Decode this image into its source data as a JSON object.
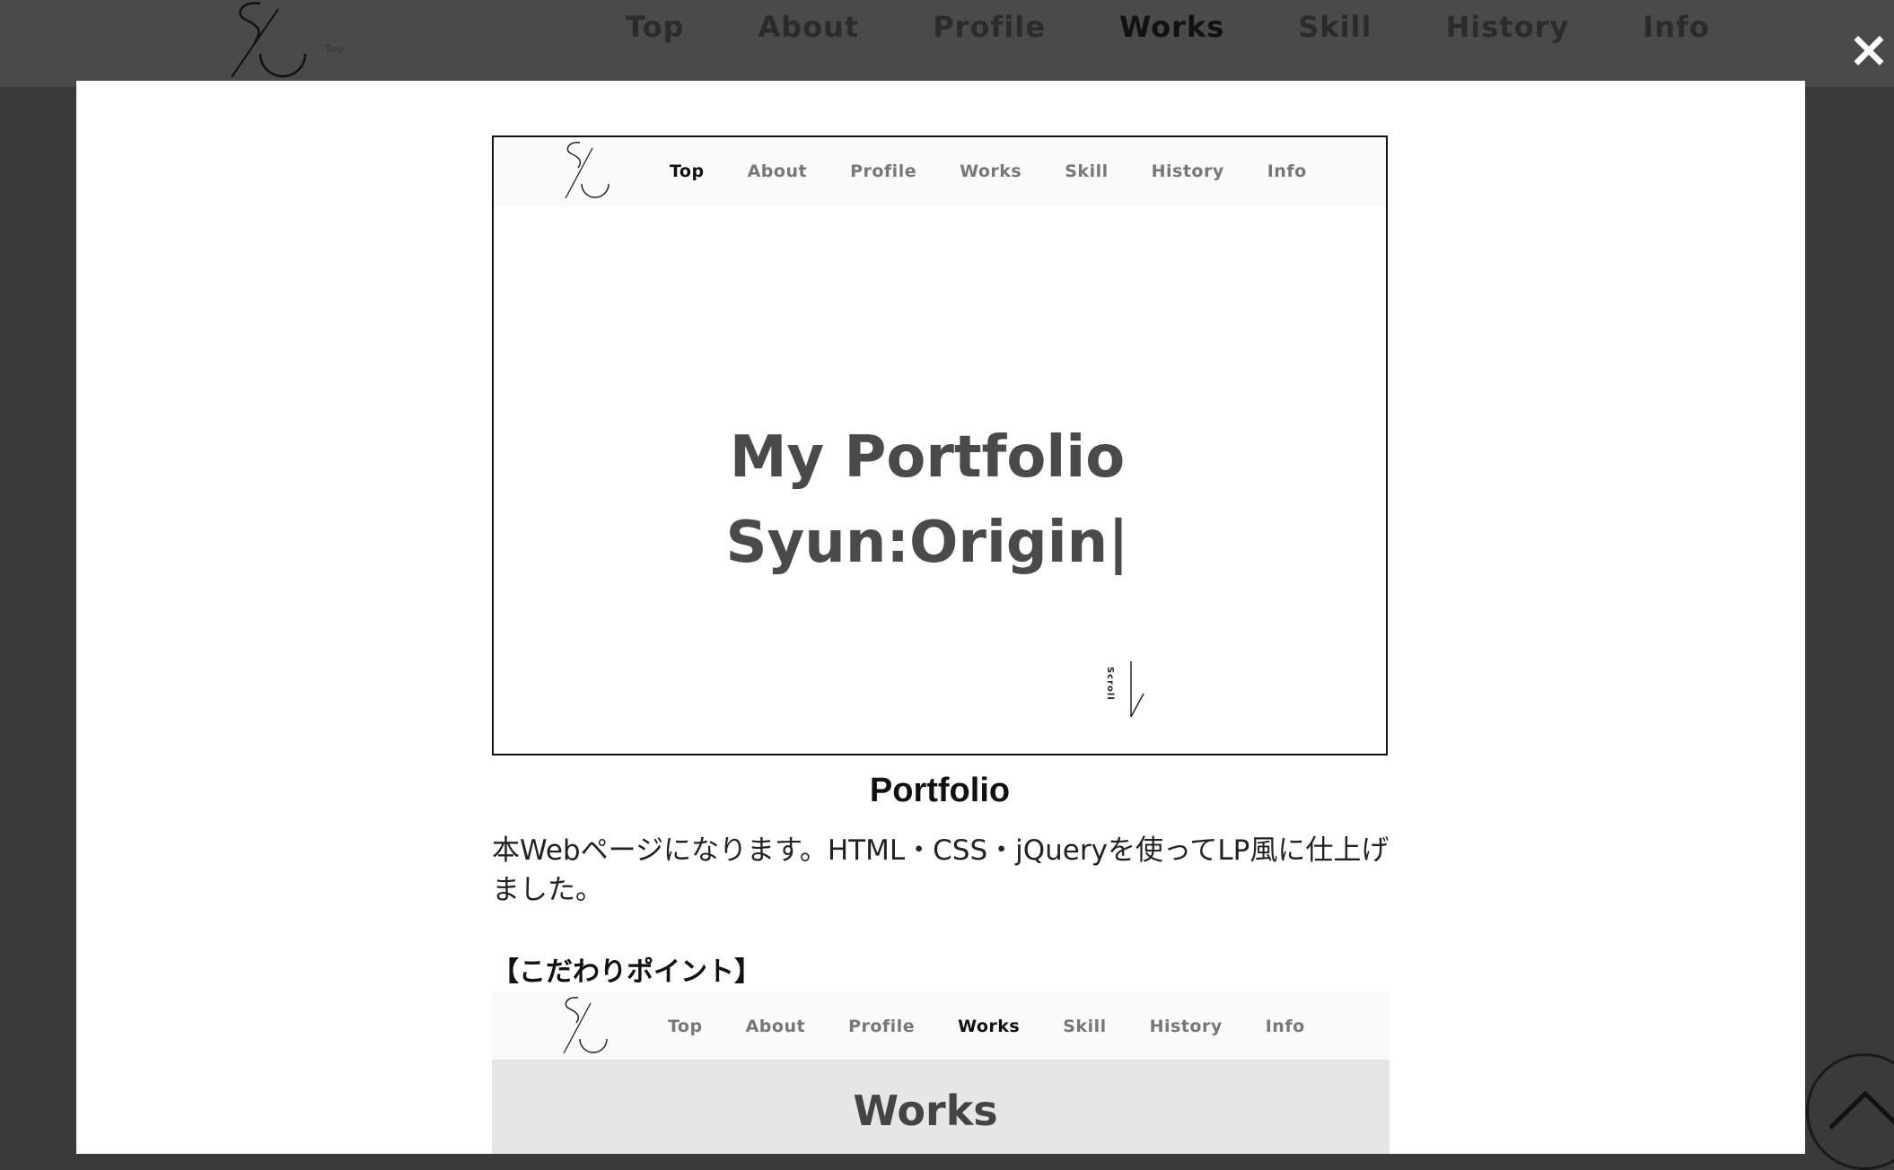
{
  "background_site": {
    "nav": [
      "Top",
      "About",
      "Profile",
      "Works",
      "Skill",
      "History",
      "Info"
    ],
    "active": "Works",
    "tiny_text": "Top   ·   ·   ·   ·"
  },
  "close_label": "×",
  "modal": {
    "screenshot_hero": {
      "nav": [
        "Top",
        "About",
        "Profile",
        "Works",
        "Skill",
        "History",
        "Info"
      ],
      "active": "Top",
      "hero_line1": "My Portfolio",
      "hero_line2": "Syun:Origin|",
      "scroll_label": "Scroll"
    },
    "title": "Portfolio",
    "description": "本Webページになります。HTML・CSS・jQueryを使ってLP風に仕上げました。",
    "points_heading": "【こだわりポイント】",
    "screenshot_works": {
      "nav": [
        "Top",
        "About",
        "Profile",
        "Works",
        "Skill",
        "History",
        "Info"
      ],
      "active": "Works",
      "section_title": "Works"
    }
  },
  "icons": {
    "logo": "so-monogram-logo",
    "close": "close-icon",
    "scroll_top": "chevron-up-icon"
  }
}
